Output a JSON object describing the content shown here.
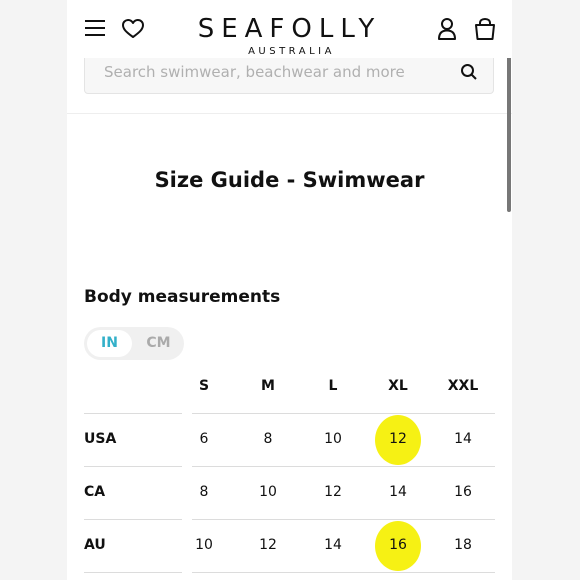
{
  "header": {
    "logo_main": "SEAFOLLY",
    "logo_sub": "AUSTRALIA",
    "icons": [
      "menu-icon",
      "heart-icon",
      "account-icon",
      "bag-icon"
    ]
  },
  "search": {
    "placeholder": "Search swimwear, beachwear and more",
    "icon": "search-icon"
  },
  "page_title": "Size Guide - Swimwear",
  "section_title": "Body measurements",
  "unit_toggle": {
    "active": "IN",
    "inactive": "CM",
    "active_color": "#33b0c9"
  },
  "size_table": {
    "columns": [
      "S",
      "M",
      "L",
      "XL",
      "XXL"
    ],
    "rows": [
      {
        "label": "USA",
        "values": [
          "6",
          "8",
          "10",
          "12",
          "14"
        ]
      },
      {
        "label": "CA",
        "values": [
          "8",
          "10",
          "12",
          "14",
          "16"
        ]
      },
      {
        "label": "AU",
        "values": [
          "10",
          "12",
          "14",
          "16",
          "18"
        ]
      }
    ],
    "highlighted_cells": [
      {
        "row": "USA",
        "column": "XL",
        "value": "12"
      },
      {
        "row": "AU",
        "column": "XL",
        "value": "16"
      }
    ],
    "highlight_color": "#f5f000"
  }
}
